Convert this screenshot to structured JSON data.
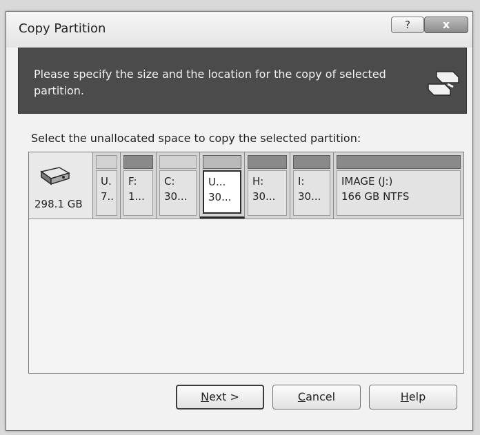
{
  "window": {
    "title": "Copy Partition",
    "help_glyph": "?",
    "close_glyph": "x"
  },
  "banner": {
    "text": "Please specify the size and the location for the copy of selected partition.",
    "icon": "copy-disk-icon"
  },
  "prompt": "Select the unallocated space to copy the selected partition:",
  "disk": {
    "icon": "hard-disk-icon",
    "size": "298.1 GB"
  },
  "partitions": [
    {
      "line1": "U.",
      "line2": "7..",
      "style": "light"
    },
    {
      "line1": "F:",
      "line2": "1...",
      "style": "dark"
    },
    {
      "line1": "C:",
      "line2": "30...",
      "style": "light"
    },
    {
      "line1": "U...",
      "line2": "30...",
      "style": "mid",
      "selected": true
    },
    {
      "line1": "H:",
      "line2": "30...",
      "style": "dark"
    },
    {
      "line1": "I:",
      "line2": "30...",
      "style": "dark"
    },
    {
      "line1": "IMAGE (J:)",
      "line2": "166 GB  NTFS",
      "style": "dark"
    }
  ],
  "buttons": {
    "next_mnemonic": "N",
    "next_rest": "ext >",
    "cancel_mnemonic": "C",
    "cancel_rest": "ancel",
    "help_mnemonic": "H",
    "help_rest": "elp"
  }
}
